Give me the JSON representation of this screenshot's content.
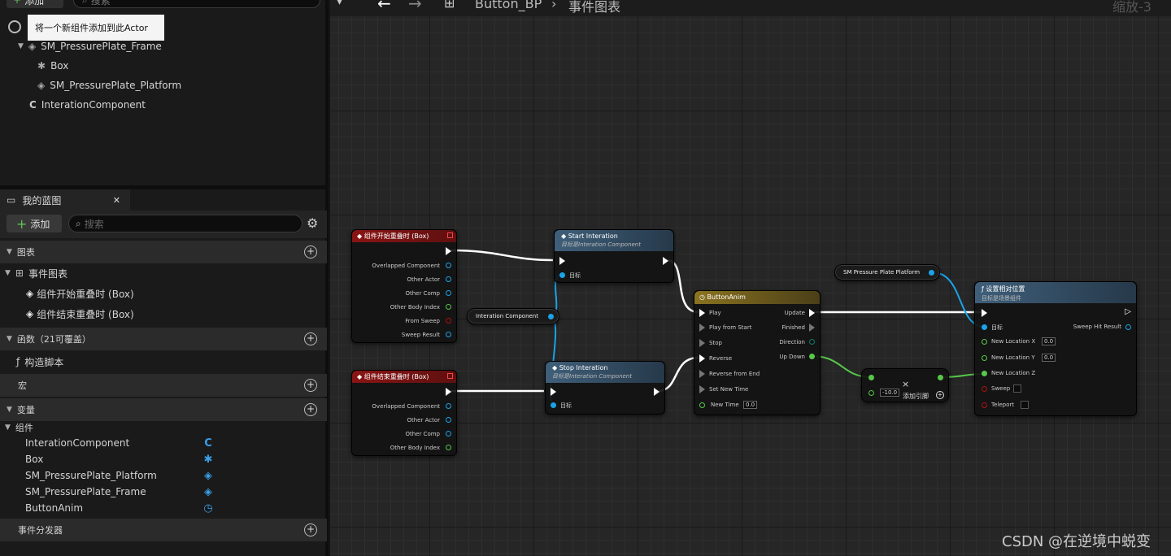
{
  "components_panel": {
    "add_label": "添加",
    "search_placeholder": "搜索",
    "tooltip": "将一个新组件添加到此Actor",
    "tree": [
      "SM_PressurePlate_Frame",
      "Box",
      "SM_PressurePlate_Platform",
      "InterationComponent"
    ]
  },
  "my_blueprint": {
    "tab_label": "我的蓝图",
    "add_label": "添加",
    "search_placeholder": "搜索",
    "graphs_label": "图表",
    "event_graph_label": "事件图表",
    "events": [
      "组件开始重叠时 (Box)",
      "组件结束重叠时 (Box)"
    ],
    "functions_label": "函数（21可覆盖）",
    "construction_script": "构造脚本",
    "macros_label": "宏",
    "variables_label": "变量",
    "components_label": "组件",
    "variables": [
      "InterationComponent",
      "Box",
      "SM_PressurePlate_Platform",
      "SM_PressurePlate_Frame",
      "ButtonAnim"
    ],
    "dispatchers_label": "事件分发器"
  },
  "graph_toolbar": {
    "breadcrumb_bp": "Button_BP",
    "breadcrumb_graph": "事件图表",
    "zoom": "缩放-3"
  },
  "nodes": {
    "begin_overlap": {
      "title": "组件开始重叠时 (Box)",
      "pins": [
        "Overlapped Component",
        "Other Actor",
        "Other Comp",
        "Other Body Index",
        "From Sweep",
        "Sweep Result"
      ]
    },
    "end_overlap": {
      "title": "组件结束重叠时 (Box)",
      "pins": [
        "Overlapped Component",
        "Other Actor",
        "Other Comp",
        "Other Body Index"
      ]
    },
    "start_interation": {
      "title": "Start Interation",
      "subtitle": "目标是Interation Component",
      "target": "目标"
    },
    "stop_interation": {
      "title": "Stop Interation",
      "subtitle": "目标是Interation Component",
      "target": "目标"
    },
    "interaction_var": "Interation Component",
    "platform_var": "SM Pressure Plate Platform",
    "timeline": {
      "title": "ButtonAnim",
      "inputs": [
        "Play",
        "Play from Start",
        "Stop",
        "Reverse",
        "Reverse from End",
        "Set New Time",
        "New Time"
      ],
      "new_time_value": "0.0",
      "outputs": [
        "Update",
        "Finished",
        "Direction",
        "Up Down"
      ]
    },
    "add_node": {
      "value": "-10.0",
      "add_pin": "添加引脚"
    },
    "set_location": {
      "title": "设置相对位置",
      "subtitle": "目标是场景组件",
      "target": "目标",
      "sweep_hit": "Sweep Hit Result",
      "loc_x": "New Location X",
      "loc_x_val": "0.0",
      "loc_y": "New Location Y",
      "loc_y_val": "0.0",
      "loc_z": "New Location Z",
      "sweep": "Sweep",
      "teleport": "Teleport"
    }
  },
  "watermark": "CSDN @在逆境中蜕变",
  "colors": {
    "accent_blue": "#1aa3e8",
    "float_green": "#57c84a",
    "event_red": "#8b1414",
    "timeline_gold": "#8a7320"
  }
}
